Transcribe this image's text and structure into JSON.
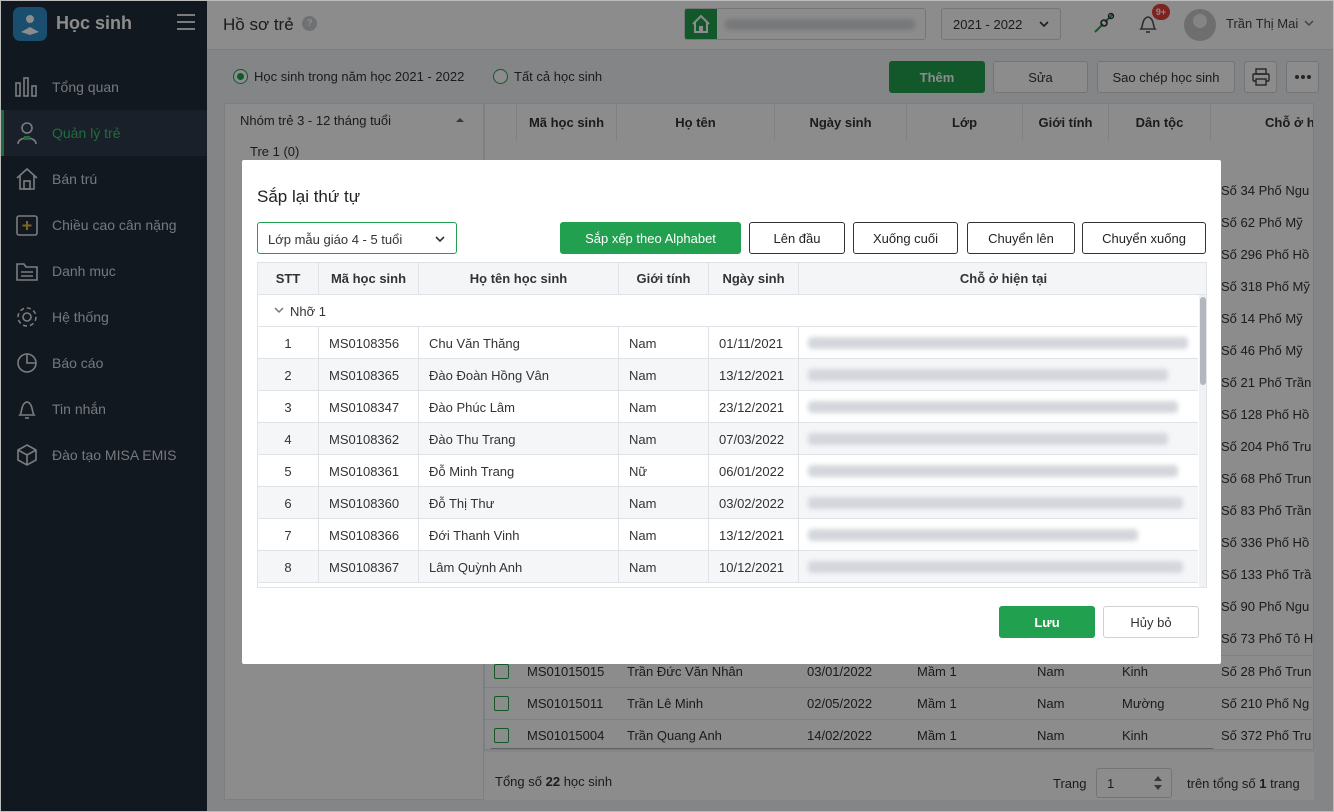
{
  "app": {
    "name": "Học sinh"
  },
  "sidebar": {
    "items": [
      {
        "label": "Tổng quan"
      },
      {
        "label": "Quản lý trẻ"
      },
      {
        "label": "Bán trú"
      },
      {
        "label": "Chiều cao cân nặng"
      },
      {
        "label": "Danh mục"
      },
      {
        "label": "Hệ thống"
      },
      {
        "label": "Báo cáo"
      },
      {
        "label": "Tin nhắn"
      },
      {
        "label": "Đào tạo MISA EMIS"
      }
    ]
  },
  "header": {
    "title": "Hồ sơ trẻ",
    "help": "?",
    "school_year": "2021 - 2022",
    "notification_badge": "9+",
    "user_name": "Trần Thị Mai"
  },
  "toolbar": {
    "radio_current": "Học sinh trong năm học 2021 - 2022",
    "radio_all": "Tất cả học sinh",
    "add": "Thêm",
    "edit": "Sửa",
    "copy": "Sao chép học sinh"
  },
  "left_panel": {
    "group_label": "Nhóm trẻ 3 - 12 tháng tuổi",
    "class_label": "Tre 1 (0)"
  },
  "background_table": {
    "headers": [
      "Mã học sinh",
      "Họ tên",
      "Ngày sinh",
      "Lớp",
      "Giới tính",
      "Dân tộc",
      "Chỗ ở h"
    ],
    "address_column": [
      "Số 34 Phố Ngu",
      "Số 62 Phố Mỹ",
      "Số 296 Phố Hồ",
      "Số 318 Phố Mỹ",
      "Số 14 Phố Mỹ",
      "Số 46 Phố Mỹ",
      "Số 21 Phố Trần",
      "Số 128 Phố Hồ",
      "Số 204 Phố Tru",
      "Số 68 Phố Trun",
      "Số 83 Phố Trần",
      "Số 336 Phố Hồ",
      "Số 133 Phố Trầ",
      "Số 90 Phố Ngu",
      "Số 73 Phố Tô H"
    ],
    "rows": [
      {
        "id": "MS01015015",
        "name": "Trần Đức Văn Nhân",
        "dob": "03/01/2022",
        "class": "Mầm 1",
        "gender": "Nam",
        "ethnic": "Kinh",
        "address": "Số 28 Phố Trun"
      },
      {
        "id": "MS01015011",
        "name": "Trần Lê Minh",
        "dob": "02/05/2022",
        "class": "Mầm 1",
        "gender": "Nam",
        "ethnic": "Mường",
        "address": "Số 210 Phố Ng"
      },
      {
        "id": "MS01015004",
        "name": "Trần Quang Anh",
        "dob": "14/02/2022",
        "class": "Mầm 1",
        "gender": "Nam",
        "ethnic": "Kinh",
        "address": "Số 372 Phố Tru"
      }
    ],
    "total_prefix": "Tổng số",
    "total_count": "22",
    "total_suffix": "học sinh",
    "page_label": "Trang",
    "page_value": "1",
    "page_total_prefix": "trên tổng số",
    "page_total": "1",
    "page_total_suffix": "trang"
  },
  "modal": {
    "title": "Sắp lại thứ tự",
    "class_select": "Lớp mẫu giáo 4 - 5 tuổi",
    "buttons": {
      "sort_alpha": "Sắp xếp theo Alphabet",
      "to_top": "Lên đầu",
      "to_bottom": "Xuống cuối",
      "move_up": "Chuyển lên",
      "move_down": "Chuyển xuống"
    },
    "headers": [
      "STT",
      "Mã học sinh",
      "Họ tên học sinh",
      "Giới tính",
      "Ngày sinh",
      "Chỗ ở hiện tại"
    ],
    "group": "Nhỡ 1",
    "rows": [
      {
        "stt": "1",
        "id": "MS0108356",
        "name": "Chu Văn Thăng",
        "gender": "Nam",
        "dob": "01/11/2021"
      },
      {
        "stt": "2",
        "id": "MS0108365",
        "name": "Đào Đoàn Hồng Vân",
        "gender": "Nam",
        "dob": "13/12/2021"
      },
      {
        "stt": "3",
        "id": "MS0108347",
        "name": "Đào Phúc Lâm",
        "gender": "Nam",
        "dob": "23/12/2021"
      },
      {
        "stt": "4",
        "id": "MS0108362",
        "name": "Đào Thu Trang",
        "gender": "Nam",
        "dob": "07/03/2022"
      },
      {
        "stt": "5",
        "id": "MS0108361",
        "name": "Đỗ Minh Trang",
        "gender": "Nữ",
        "dob": "06/01/2022"
      },
      {
        "stt": "6",
        "id": "MS0108360",
        "name": "Đỗ Thị Thư",
        "gender": "Nam",
        "dob": "03/02/2022"
      },
      {
        "stt": "7",
        "id": "MS0108366",
        "name": "Đới Thanh Vinh",
        "gender": "Nam",
        "dob": "13/12/2021"
      },
      {
        "stt": "8",
        "id": "MS0108367",
        "name": "Lâm Quỳnh Anh",
        "gender": "Nam",
        "dob": "10/12/2021"
      }
    ],
    "save": "Lưu",
    "cancel": "Hủy bỏ"
  },
  "colors": {
    "accent": "#21a04f",
    "sidebar_bg": "#222c3a",
    "active_menu": "#3ec46d",
    "badge": "#e8413c"
  }
}
